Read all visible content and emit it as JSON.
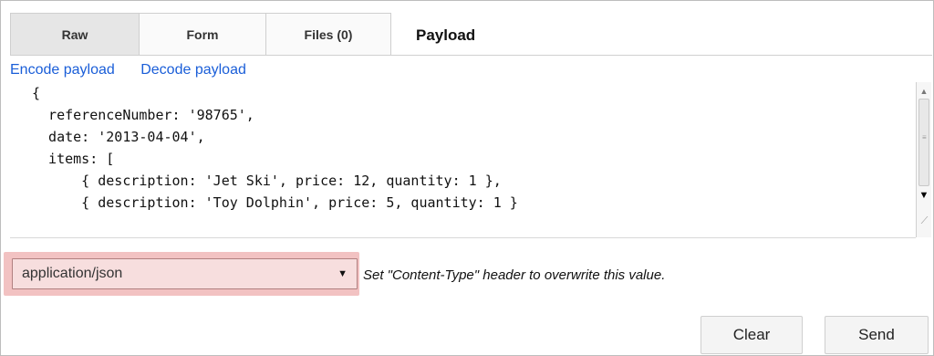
{
  "tabs": [
    {
      "label": "Raw",
      "active": true
    },
    {
      "label": "Form",
      "active": false
    },
    {
      "label": "Files (0)",
      "active": false
    }
  ],
  "section_title": "Payload",
  "links": {
    "encode": "Encode payload",
    "decode": "Decode payload"
  },
  "editor": {
    "content": "{\n  referenceNumber: '98765',\n  date: '2013-04-04',\n  items: [\n      { description: 'Jet Ski', price: 12, quantity: 1 },\n      { description: 'Toy Dolphin', price: 5, quantity: 1 }"
  },
  "content_type": {
    "value": "application/json",
    "hint": "Set \"Content-Type\" header to overwrite this value."
  },
  "buttons": {
    "clear": "Clear",
    "send": "Send"
  },
  "colors": {
    "link": "#1a5ed8",
    "highlight": "#f2c2c2"
  }
}
